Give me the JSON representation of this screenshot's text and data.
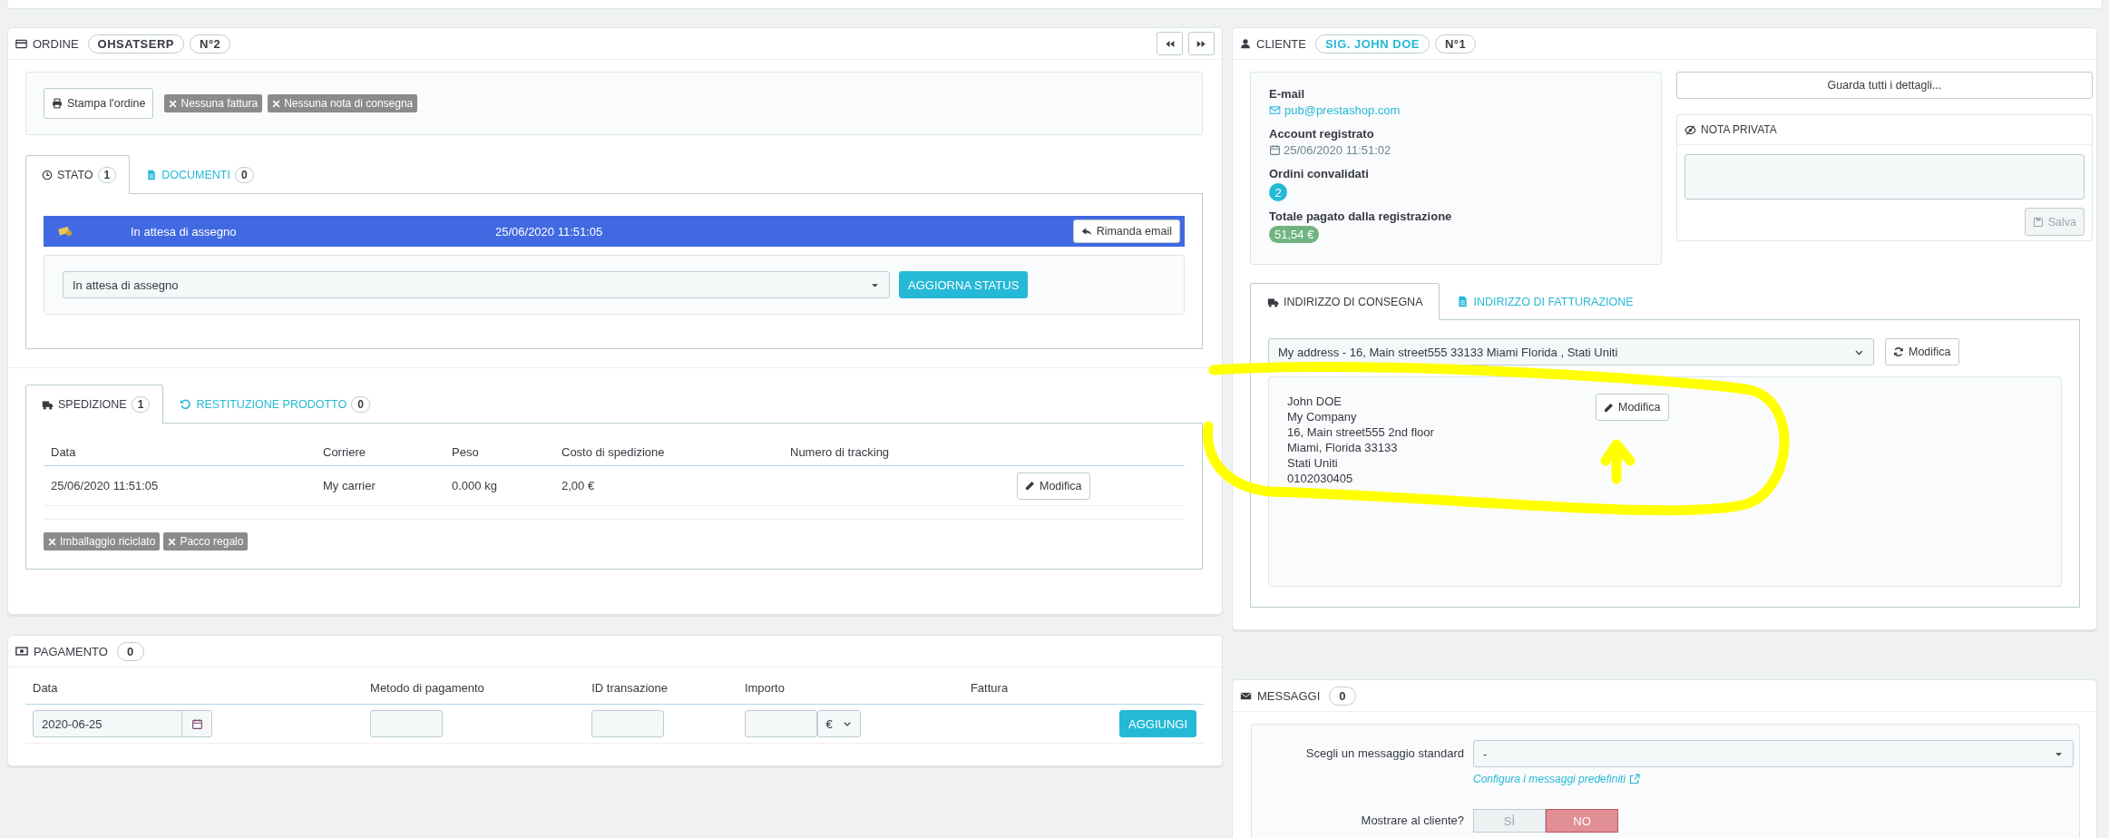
{
  "order": {
    "title": "ORDINE",
    "reference": "OHSATSERP",
    "number": "N°2",
    "print_button": "Stampa l'ordine",
    "document_badges": [
      "Nessuna fattura",
      "Nessuna nota di consegna"
    ],
    "status_tabs": [
      {
        "label": "STATO",
        "count": "1",
        "selected": true
      },
      {
        "label": "DOCUMENTI",
        "count": "0",
        "selected": false
      }
    ],
    "status_history": [
      {
        "status": "In attesa di assegno",
        "date": "25/06/2020 11:51:05",
        "color": "#4169e1",
        "button": "Rimanda email"
      }
    ],
    "status_select": {
      "value": "In attesa di assegno",
      "button": "AGGIORNA STATUS"
    },
    "shipping_tabs": [
      {
        "label": "SPEDIZIONE",
        "count": "1",
        "selected": true
      },
      {
        "label": "RESTITUZIONE PRODOTTO",
        "count": "0",
        "selected": false
      }
    ],
    "shipping_table": {
      "columns": [
        "Data",
        "Corriere",
        "Peso",
        "Costo di spedizione",
        "Numero di tracking"
      ],
      "rows": [
        {
          "cells": [
            "25/06/2020 11:51:05",
            "My carrier",
            "0.000 kg",
            "2,00 €",
            ""
          ],
          "button": "Modifica"
        }
      ]
    },
    "shipping_badges": [
      "Imballaggio riciclato",
      "Pacco regalo"
    ]
  },
  "payment": {
    "title": "PAGAMENTO",
    "count": "0",
    "columns": [
      "Data",
      "Metodo di pagamento",
      "ID transazione",
      "Importo",
      "Fattura"
    ],
    "date": "2020-06-25",
    "currency": "€",
    "button": "AGGIUNGI"
  },
  "customer": {
    "title": "CLIENTE",
    "name": "SIG. JOHN DOE",
    "number": "N°1",
    "fields": [
      {
        "label": "E-mail",
        "value": "pub@prestashop.com",
        "kind": "email"
      },
      {
        "label": "Account registrato",
        "value": "25/06/2020 11:51:02",
        "kind": "date"
      },
      {
        "label": "Ordini convalidati",
        "value": "2",
        "kind": "count"
      },
      {
        "label": "Totale pagato dalla registrazione",
        "value": "51,54 €",
        "kind": "money"
      }
    ],
    "details_button": "Guarda tutti i dettagli...",
    "private_note": {
      "title": "NOTA PRIVATA",
      "save": "Salva",
      "disabled": true
    },
    "address_tabs": [
      {
        "label": "INDIRIZZO DI CONSEGNA",
        "kind": "delivery",
        "selected": true
      },
      {
        "label": "INDIRIZZO DI FATTURAZIONE",
        "kind": "invoice",
        "selected": false
      }
    ],
    "address_select": {
      "value": "My address - 16, Main street555 33133 Miami Florida , Stati Uniti",
      "button": "Modifica"
    },
    "address": {
      "lines": [
        "John DOE",
        "My Company",
        "16, Main street555 2nd floor",
        "Miami, Florida 33133",
        "Stati Uniti",
        "0102030405"
      ],
      "button": "Modifica"
    }
  },
  "messages": {
    "title": "MESSAGGI",
    "count": "0",
    "standard_label": "Scegli un messaggio standard",
    "standard_value": "-",
    "configure_link": "Configura i messaggi predefiniti",
    "show_label": "Mostrare al cliente?",
    "options": [
      {
        "label": "SÌ",
        "selected": false
      },
      {
        "label": "NO",
        "selected": true
      }
    ]
  }
}
